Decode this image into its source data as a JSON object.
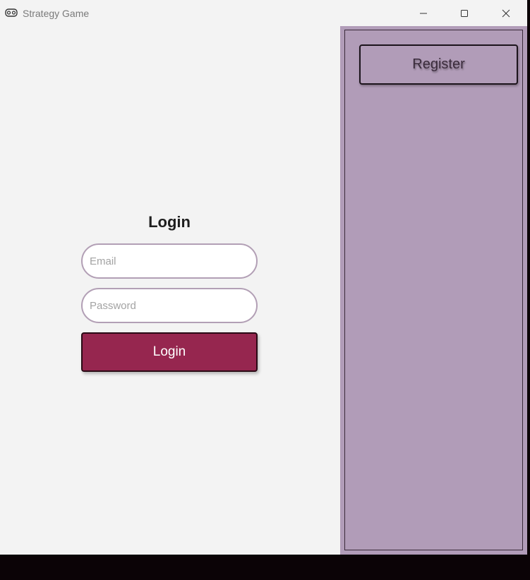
{
  "window": {
    "title": "Strategy Game",
    "app_icon": "gamepad-icon",
    "controls": [
      "minimize-icon",
      "maximize-icon",
      "close-icon"
    ]
  },
  "login": {
    "heading": "Login",
    "email_placeholder": "Email",
    "email_value": "",
    "password_placeholder": "Password",
    "password_value": "",
    "submit_label": "Login"
  },
  "sidebar": {
    "register_label": "Register"
  },
  "colors": {
    "accent": "#96264f",
    "sidebar_bg": "#b19cb8",
    "field_border": "#b29fb5",
    "window_bg": "#f3f3f3"
  }
}
